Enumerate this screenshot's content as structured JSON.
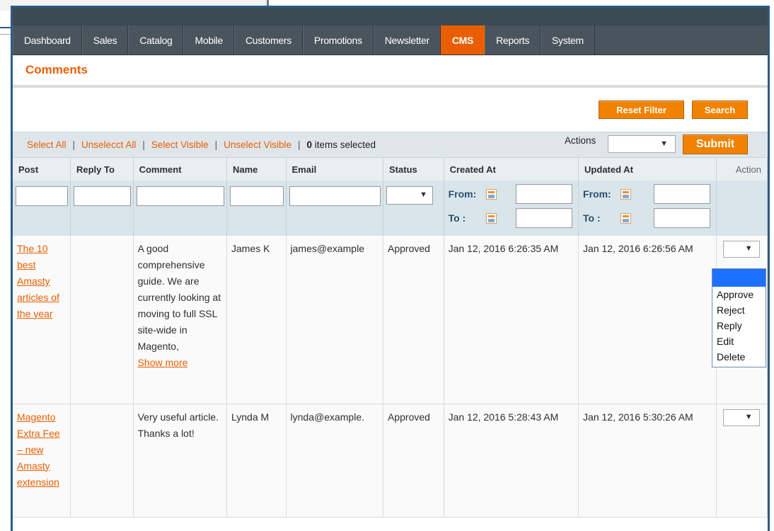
{
  "nav": {
    "items": [
      {
        "label": "Dashboard"
      },
      {
        "label": "Sales"
      },
      {
        "label": "Catalog"
      },
      {
        "label": "Mobile"
      },
      {
        "label": "Customers"
      },
      {
        "label": "Promotions"
      },
      {
        "label": "Newsletter"
      },
      {
        "label": "CMS",
        "active": true
      },
      {
        "label": "Reports"
      },
      {
        "label": "System"
      }
    ]
  },
  "page": {
    "title": "Comments",
    "reset_filter": "Reset Filter",
    "search": "Search"
  },
  "massaction": {
    "select_all": "Select All",
    "unselect_all": "Unselecct All",
    "select_visible": "Select Visible",
    "unselect_visible": "Unselect Visible",
    "separator": "|",
    "count_num": "0",
    "count_label": "items selected",
    "actions_label": "Actions",
    "submit": "Submit"
  },
  "grid": {
    "headers": {
      "post": "Post",
      "reply_to": "Reply To",
      "comment": "Comment",
      "name": "Name",
      "email": "Email",
      "status": "Status",
      "created_at": "Created At",
      "updated_at": "Updated At",
      "action": "Action"
    },
    "filter": {
      "from_label": "From:",
      "to_label": "To :"
    },
    "rows": [
      {
        "post": "The 10 best Amasty articles of the year",
        "reply_to": "",
        "comment": "A good comprehensive guide. We are currently looking at moving to full SSL site-wide in Magento,",
        "show_more": "Show more",
        "name": "James K",
        "email": "james@example",
        "status": "Approved",
        "created_at": "Jan 12, 2016 6:26:35 AM",
        "updated_at": "Jan 12, 2016 6:26:56 AM"
      },
      {
        "post": "Magento Extra Fee – new Amasty extension",
        "reply_to": "",
        "comment": "Very useful article. Thanks a lot!",
        "name": "Lynda M",
        "email": "lynda@example.",
        "status": "Approved",
        "created_at": "Jan 12, 2016 5:28:43 AM",
        "updated_at": "Jan 12, 2016 5:30:26 AM"
      }
    ]
  },
  "action_dropdown": {
    "options": [
      "Approve",
      "Reject",
      "Reply",
      "Edit",
      "Delete"
    ]
  },
  "colors": {
    "accent": "#eb5e00",
    "button": "#f18200",
    "nav_bg": "#4a545c",
    "selection": "#1e71ff"
  }
}
